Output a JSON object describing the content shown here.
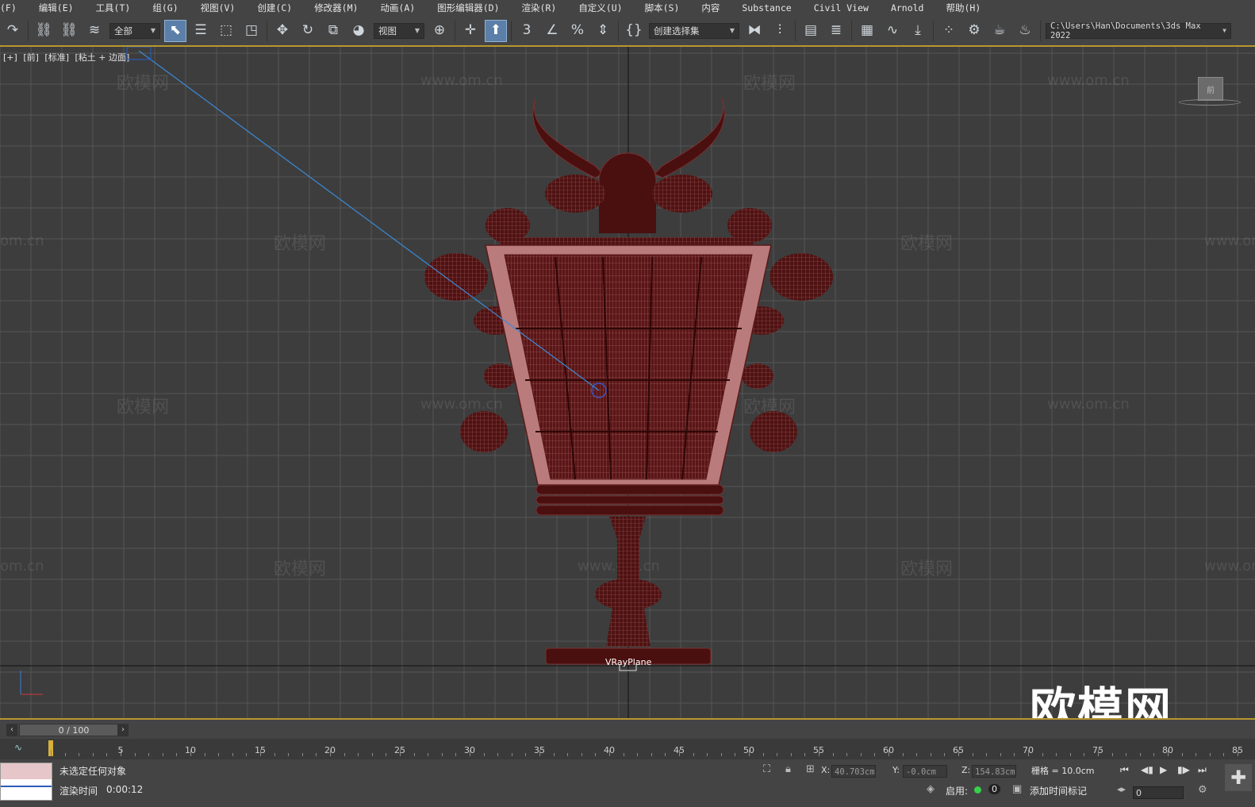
{
  "menu": {
    "items": [
      "(F)",
      "编辑(E)",
      "工具(T)",
      "组(G)",
      "视图(V)",
      "创建(C)",
      "修改器(M)",
      "动画(A)",
      "图形编辑器(D)",
      "渲染(R)",
      "自定义(U)",
      "脚本(S)",
      "内容",
      "Substance",
      "Civil View",
      "Arnold",
      "帮助(H)"
    ]
  },
  "toolbar": {
    "selection_filter": "全部",
    "ref_coord": "视图",
    "named_selection": "创建选择集",
    "project_path": "C:\\Users\\Han\\Documents\\3ds Max 2022",
    "icons": [
      "redo-icon",
      "link-icon",
      "unlink-icon",
      "bind-spacewarp-icon",
      "select-object-icon",
      "select-by-name-icon",
      "rect-select-icon",
      "window-crossing-icon",
      "move-icon",
      "rotate-icon",
      "scale-icon",
      "placement-icon",
      "pivot-icon",
      "manipulate-icon",
      "keyboard-shortcut-icon",
      "snap-3-icon",
      "angle-snap-icon",
      "percent-snap-icon",
      "spinner-snap-icon",
      "edit-named-sel-icon",
      "mirror-icon",
      "align-icon",
      "scene-explorer-icon",
      "layer-explorer-icon",
      "ribbon-icon",
      "curve-editor-icon",
      "schematic-view-icon",
      "material-editor-icon",
      "render-setup-icon",
      "render-frame-icon",
      "render-icon"
    ]
  },
  "viewport": {
    "label_parts": [
      "[+]",
      "[前]",
      "[标准]",
      "[粘土 + 边面]"
    ],
    "object_label": "VRayPlane",
    "viewcube_text": "前",
    "watermark_logo": "欧模网",
    "watermark_url": "www.om.cn",
    "watermark_url_partial": "om.cn",
    "big_logo": "欧模网"
  },
  "timeline": {
    "slider_text": "0 / 100",
    "ticks": [
      5,
      10,
      15,
      20,
      25,
      30,
      35,
      40,
      45,
      50,
      55,
      60,
      65,
      70,
      75,
      80,
      85
    ]
  },
  "status": {
    "selection_text": "未选定任何对象",
    "render_time_label": "渲染时间",
    "render_time_value": "0:00:12",
    "x_label": "X:",
    "x_value": "40.703cm",
    "y_label": "Y:",
    "y_value": "-0.0cm",
    "z_label": "Z:",
    "z_value": "154.83cm",
    "grid_text": "栅格 = 10.0cm",
    "enabled_label": "启用:",
    "enabled_count": "0",
    "add_time_tag": "添加时间标记",
    "frame_value": "0"
  },
  "colors": {
    "model_fill": "#4a0f0f",
    "model_wire": "#a86565",
    "grid_line": "#555555",
    "accent_gold": "#b8972f",
    "selection_blue": "#5b7fa8"
  }
}
